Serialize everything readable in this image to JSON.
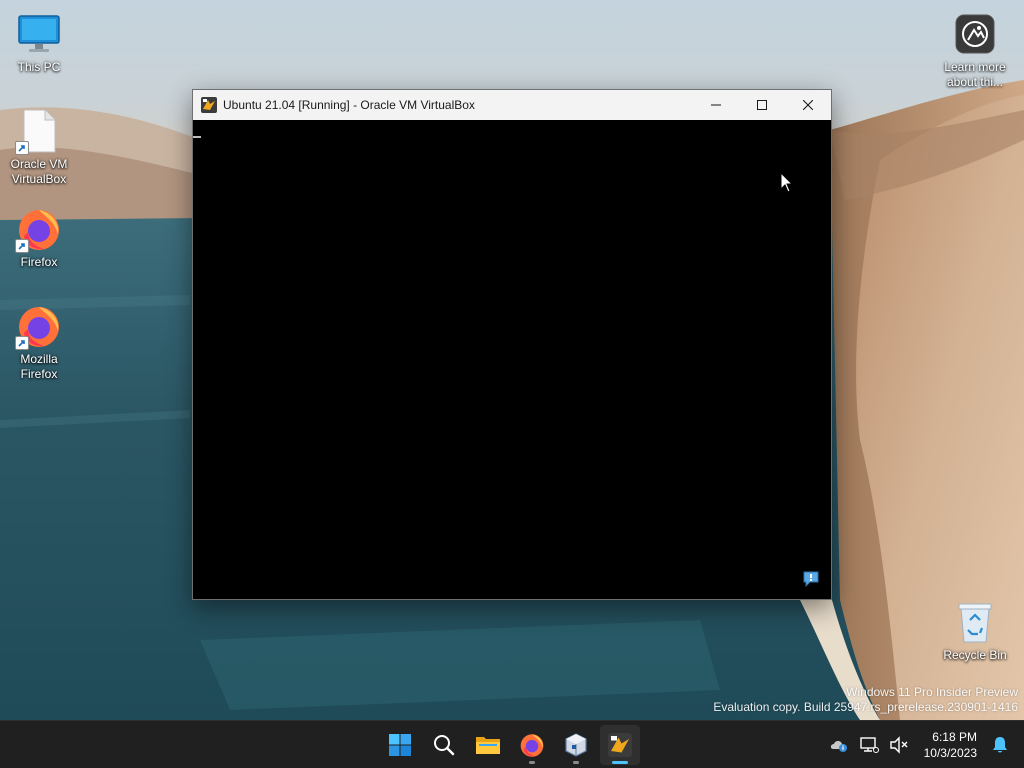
{
  "desktop": {
    "icons": [
      {
        "label": "This PC",
        "icon": "monitor-icon"
      },
      {
        "label": "Oracle VM VirtualBox",
        "icon": "file-shortcut-icon"
      },
      {
        "label": "Firefox",
        "icon": "firefox-icon"
      },
      {
        "label": "Mozilla Firefox",
        "icon": "firefox-icon"
      },
      {
        "label": "Learn more about thi...",
        "icon": "learn-more-icon"
      },
      {
        "label": "Recycle Bin",
        "icon": "recycle-bin-icon"
      }
    ]
  },
  "vbox_window": {
    "title": "Ubuntu 21.04 [Running] - Oracle VM VirtualBox",
    "state": "Running"
  },
  "watermark": {
    "line1": "Windows 11 Pro Insider Preview",
    "line2": "Evaluation copy. Build 25947.rs_prerelease.230901-1416"
  },
  "taskbar": {
    "items": [
      {
        "name": "start",
        "icon": "windows-logo-icon"
      },
      {
        "name": "search",
        "icon": "search-icon"
      },
      {
        "name": "file-explorer",
        "icon": "folder-icon"
      },
      {
        "name": "firefox",
        "icon": "firefox-icon",
        "running": true
      },
      {
        "name": "virtualbox-manager",
        "icon": "virtualbox-icon",
        "running": true
      },
      {
        "name": "virtualbox-vm",
        "icon": "vbox-vm-icon",
        "active": true
      }
    ],
    "clock": {
      "time": "6:18 PM",
      "date": "10/3/2023"
    }
  },
  "colors": {
    "taskbar_bg": "#202020",
    "accent": "#4cc2ff",
    "titlebar_bg": "#f3f3f3",
    "vm_screen": "#000000"
  }
}
